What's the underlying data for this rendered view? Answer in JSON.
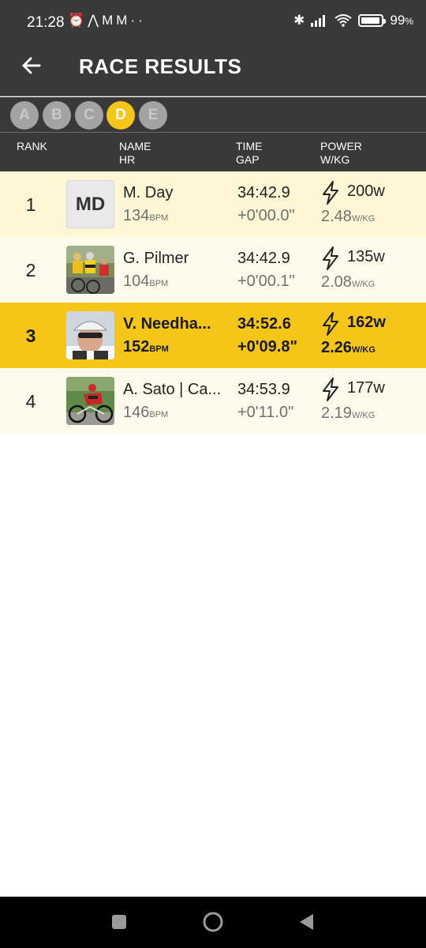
{
  "status": {
    "time": "21:28",
    "battery": "99",
    "battery_suffix": "%"
  },
  "header": {
    "title": "RACE RESULTS"
  },
  "categories": [
    {
      "label": "A",
      "active": false
    },
    {
      "label": "B",
      "active": false
    },
    {
      "label": "C",
      "active": false
    },
    {
      "label": "D",
      "active": true
    },
    {
      "label": "E",
      "active": false
    }
  ],
  "columns": {
    "rank": "RANK",
    "name": "NAME",
    "hr": "HR",
    "time": "TIME",
    "gap": "GAP",
    "power": "POWER",
    "wkg": "W/KG"
  },
  "units": {
    "bpm": "BPM",
    "wkg": "W/KG"
  },
  "rows": [
    {
      "rank": "1",
      "avatar_text": "MD",
      "name": "M. Day",
      "hr": "134",
      "time": "34:42.9",
      "gap": "+0'00.0\"",
      "power": "200w",
      "wkg": "2.48",
      "highlight": false,
      "bg": "#fff6d6"
    },
    {
      "rank": "2",
      "avatar_text": "",
      "name": "G. Pilmer",
      "hr": "104",
      "time": "34:42.9",
      "gap": "+0'00.1\"",
      "power": "135w",
      "wkg": "2.08",
      "highlight": false,
      "bg": "#fffbec"
    },
    {
      "rank": "3",
      "avatar_text": "",
      "name": "V. Needha...",
      "hr": "152",
      "time": "34:52.6",
      "gap": "+0'09.8\"",
      "power": "162w",
      "wkg": "2.26",
      "highlight": true,
      "bg": "#f5c517"
    },
    {
      "rank": "4",
      "avatar_text": "",
      "name": "A. Sato | Ca...",
      "hr": "146",
      "time": "34:53.9",
      "gap": "+0'11.0\"",
      "power": "177w",
      "wkg": "2.19",
      "highlight": false,
      "bg": "#fffbec"
    }
  ],
  "colors": {
    "accent": "#f5c517",
    "bar": "#393939"
  },
  "icons": {
    "back": "arrow-left-icon",
    "power": "lightning-bolt-icon"
  }
}
